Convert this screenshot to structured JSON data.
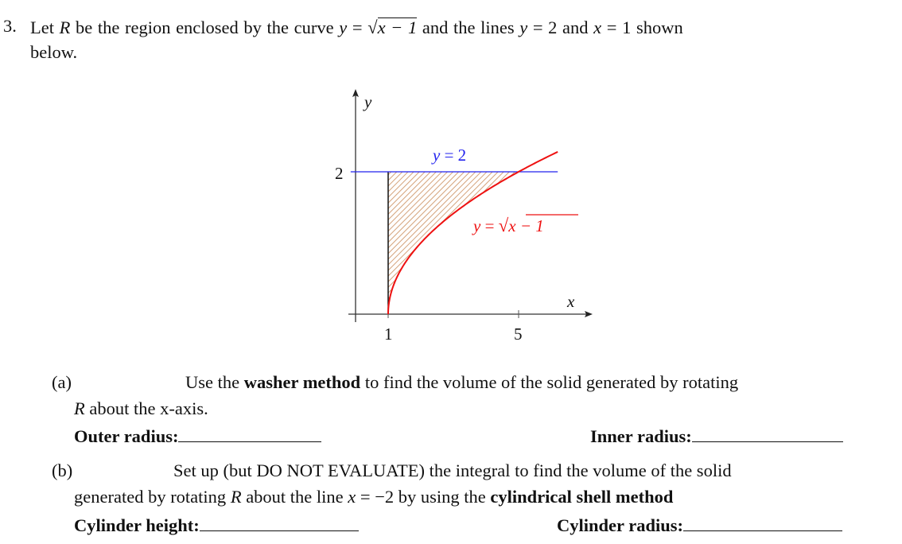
{
  "problem": {
    "number": "3.",
    "intro": {
      "p1": "Let ",
      "R": "R",
      "p2": " be the region enclosed by the curve ",
      "curve_lhs": "y",
      "eq": " = ",
      "curve_sqrt_symbol": "√",
      "curve_radicand": "x − 1",
      "p3": " and the lines ",
      "line1_lhs": "y",
      "line1_rhs": " = 2",
      "p4": " and ",
      "line2_lhs": "x",
      "line2_rhs": " = 1",
      "p5": " shown",
      "line2_text": "below."
    }
  },
  "figure": {
    "y_axis_label": "y",
    "x_axis_label": "x",
    "y_tick_label": "2",
    "x_tick_labels": [
      "1",
      "5"
    ],
    "blue_line_label_lhs": "y",
    "blue_line_label_rhs": " = 2",
    "curve_label_lhs": "y",
    "curve_label_eq": " = ",
    "curve_label_sqrt": "√",
    "curve_label_radicand": "x − 1",
    "colors": {
      "axis": "#333333",
      "line_y2": "#2222ee",
      "curve": "#ee1111",
      "hatch": "#d4a27a",
      "boundary_x1": "#000000"
    }
  },
  "chart_data": {
    "type": "line",
    "title": "",
    "xlabel": "x",
    "ylabel": "y",
    "x_ticks": [
      1,
      5
    ],
    "y_ticks": [
      2
    ],
    "xlim": [
      -0.2,
      7.2
    ],
    "ylim": [
      -0.1,
      3.2
    ],
    "grid": false,
    "series": [
      {
        "name": "y = √(x − 1)",
        "function": "sqrt(x-1)",
        "x_range": [
          1,
          6.2
        ],
        "color": "#ee1111"
      },
      {
        "name": "y = 2",
        "function": "2",
        "x_range": [
          -0.15,
          6.2
        ],
        "color": "#2222ee"
      },
      {
        "name": "x = 1",
        "segment": [
          [
            1,
            0
          ],
          [
            1,
            2
          ]
        ],
        "color": "#000000"
      }
    ],
    "shaded_region": {
      "name": "R",
      "bounds": "1 ≤ x ≤ 5, √(x−1) ≤ y ≤ 2",
      "fill": "hatched"
    },
    "annotations": [
      "y = 2",
      "y = √(x − 1)"
    ]
  },
  "part_a": {
    "label": "(a)",
    "t1": "Use the ",
    "bold1": "washer method",
    "t2": " to find the volume of the solid generated by rotating",
    "R": "R",
    "t3": " about the x-axis.",
    "field1_label": "Outer radius:",
    "field2_label": "Inner radius:"
  },
  "part_b": {
    "label": "(b)",
    "t1": "Set up (but DO NOT EVALUATE) the integral to find the volume of the solid",
    "t2": "generated by rotating ",
    "R": "R",
    "t3": " about the line ",
    "line_lhs": "x",
    "line_rhs": " = −2",
    "t4": " by using the ",
    "bold1": "cylindrical shell method",
    "field1_label": "Cylinder height:",
    "field2_label": "Cylinder radius:"
  }
}
